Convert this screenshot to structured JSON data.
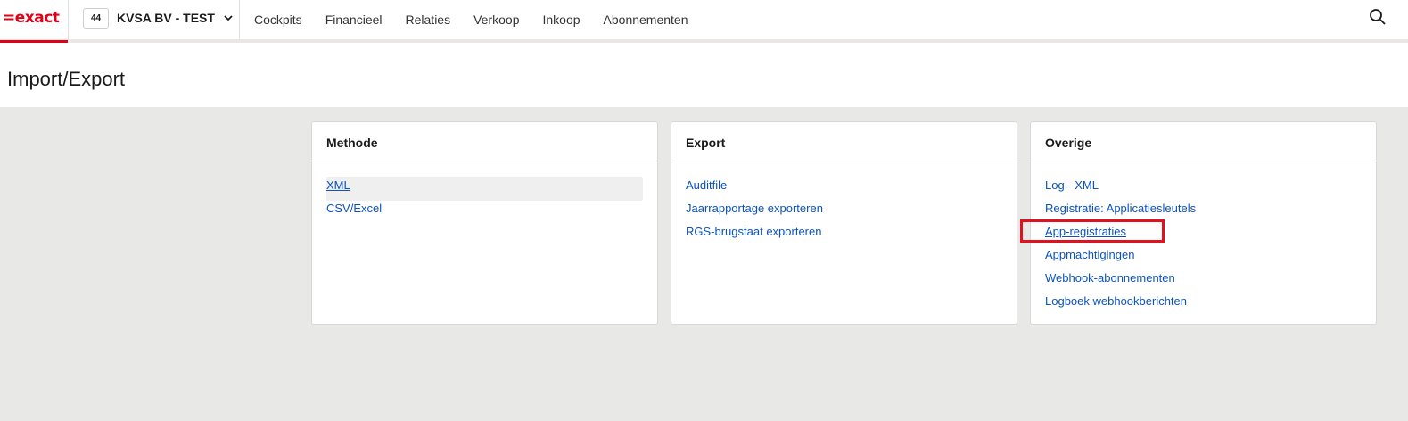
{
  "brand": {
    "logo_text": "=exact",
    "accent": "#e1001a"
  },
  "company": {
    "number": "44",
    "name": "KVSA BV - TEST"
  },
  "nav": {
    "items": [
      {
        "label": "Cockpits"
      },
      {
        "label": "Financieel"
      },
      {
        "label": "Relaties"
      },
      {
        "label": "Verkoop"
      },
      {
        "label": "Inkoop"
      },
      {
        "label": "Abonnementen"
      }
    ]
  },
  "page": {
    "title": "Import/Export"
  },
  "cards": [
    {
      "title": "Methode",
      "links": [
        "XML",
        "CSV/Excel"
      ]
    },
    {
      "title": "Export",
      "links": [
        "Auditfile",
        "Jaarrapportage exporteren",
        "RGS-brugstaat exporteren"
      ]
    },
    {
      "title": "Overige",
      "links": [
        "Log - XML",
        "Registratie: Applicatiesleutels",
        "App-registraties",
        "Appmachtigingen",
        "Webhook-abonnementen",
        "Logboek webhookberichten"
      ]
    }
  ],
  "colors": {
    "link": "#0b52c2",
    "highlight": "#e0121e",
    "background": "#e8e8e6"
  }
}
